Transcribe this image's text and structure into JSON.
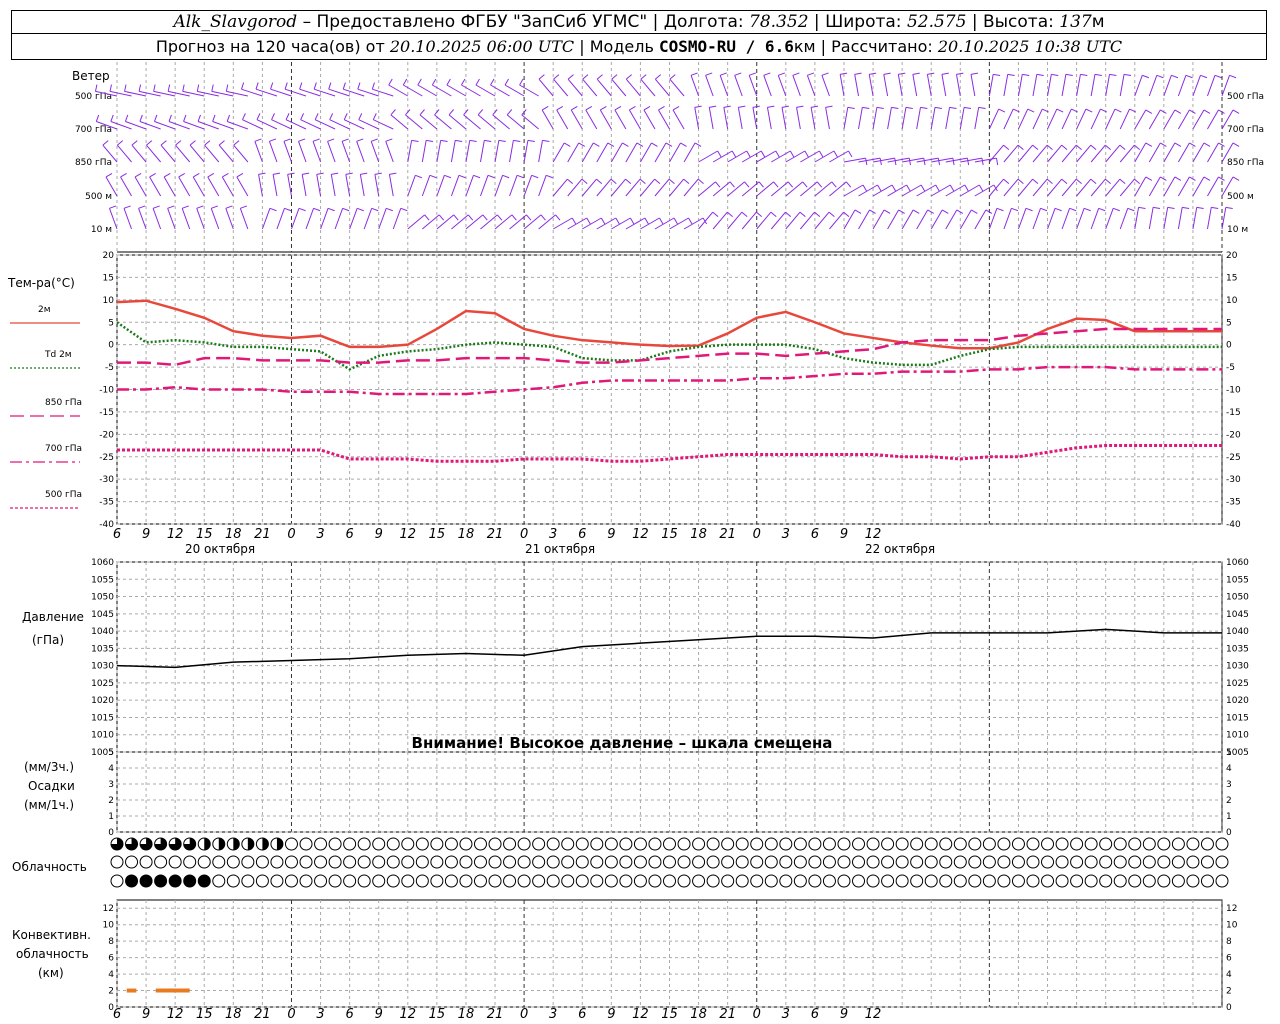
{
  "header": {
    "station": "Alk_Slavgorod",
    "provider": " – Предоставлено ФГБУ \"ЗапСиб УГМС\" | Долгота: ",
    "lon": "78.352",
    "lat_label": " | Широта: ",
    "lat": "52.575",
    "alt_label": " | Высота: ",
    "alt": "137",
    "alt_unit": "м",
    "line2_a": "Прогноз на 120 часа(ов) от ",
    "forecast_start": "20.10.2025 06:00 UTC",
    "line2_b": "  | Модель ",
    "model": "COSMO-RU / 6.6",
    "model_unit": "км",
    "line2_c": " | Рассчитано: ",
    "computed": "20.10.2025 10:38 UTC"
  },
  "wind_panel": {
    "title": "Ветер",
    "levels": [
      "500 гПа",
      "700 гПа",
      "850 гПа",
      "500 м",
      "10 м"
    ]
  },
  "temp_panel": {
    "title": "Тем-ра(°С)",
    "legend": [
      {
        "label": "2м",
        "color": "#e8483c",
        "style": "solid"
      },
      {
        "label": "Td  2м",
        "color": "#1a7a1a",
        "style": "dotted"
      },
      {
        "label": "850 гПа",
        "color": "#e0187a",
        "style": "dash"
      },
      {
        "label": "700 гПа",
        "color": "#e0187a",
        "style": "dashdot"
      },
      {
        "label": "500 гПа",
        "color": "#e0187a",
        "style": "dot"
      }
    ],
    "yticks": [
      "20",
      "15",
      "10",
      "5",
      "0",
      "-5",
      "-10",
      "-15",
      "-20",
      "-25",
      "-30",
      "-35",
      "-40"
    ]
  },
  "x_axis": {
    "hours": [
      "6",
      "9",
      "12",
      "15",
      "18",
      "21",
      "0",
      "3",
      "6",
      "9",
      "12",
      "15",
      "18",
      "21",
      "0",
      "3",
      "6",
      "9",
      "12",
      "15",
      "18",
      "21",
      "0",
      "3",
      "6",
      "9",
      "12"
    ],
    "dates": [
      "20 октября",
      "21 октября",
      "22 октября"
    ]
  },
  "pressure_panel": {
    "title": "Давление",
    "unit": "(гПа)",
    "yticks": [
      "1060",
      "1055",
      "1050",
      "1045",
      "1040",
      "1035",
      "1030",
      "1025",
      "1020",
      "1015",
      "1010",
      "1005"
    ],
    "warning": "Внимание! Высокое давление – шкала смещена"
  },
  "precip_panel": {
    "unit3": "(мм/3ч.)",
    "title": "Осадки",
    "unit1": "(мм/1ч.)",
    "yticks": [
      "5",
      "4",
      "3",
      "2",
      "1",
      "0"
    ]
  },
  "cloud_panel": {
    "title": "Облачность"
  },
  "conv_panel": {
    "title1": "Конвективн.",
    "title2": "облачность",
    "unit": "(км)",
    "yticks": [
      "12",
      "10",
      "8",
      "6",
      "4",
      "2",
      "0"
    ]
  },
  "colors": {
    "wind": "#8a2be2",
    "t2m": "#e8483c",
    "td": "#1a7a1a",
    "upper": "#e0187a",
    "pressure": "#000000",
    "conv": "#e87a20"
  },
  "chart_data": [
    {
      "type": "line",
      "title": "Тем-ра(°С)",
      "x_hours_from_start": [
        0,
        3,
        6,
        9,
        12,
        15,
        18,
        21,
        24,
        27,
        30,
        33,
        36,
        39,
        42,
        45,
        48,
        51,
        54,
        57,
        60,
        63,
        66,
        69,
        72,
        75,
        78,
        81,
        84,
        87,
        90,
        93,
        96,
        99,
        102,
        105,
        108,
        111,
        114
      ],
      "ylim": [
        -40,
        20
      ],
      "series": [
        {
          "name": "2м",
          "values": [
            9.5,
            9.8,
            8,
            6,
            3,
            2,
            1.5,
            2,
            -0.5,
            -0.5,
            0,
            3.5,
            7.5,
            7,
            3.5,
            2,
            1,
            0.5,
            0,
            -0.3,
            -0.2,
            2.5,
            6,
            7.3,
            5,
            2.5,
            1.5,
            0.5,
            -0.2,
            -0.8,
            -0.8,
            0.5,
            3.5,
            5.8,
            5.5,
            3,
            3,
            3,
            3
          ]
        },
        {
          "name": "Td  2м",
          "values": [
            5,
            0.5,
            1,
            0.5,
            -0.5,
            -0.5,
            -1,
            -1.5,
            -5.5,
            -2.5,
            -1.5,
            -1,
            0,
            0.5,
            0,
            -0.5,
            -3,
            -3.5,
            -3.5,
            -1.5,
            -0.5,
            0,
            0,
            0,
            -1,
            -3,
            -4,
            -4.5,
            -4.5,
            -2.5,
            -1,
            -0.5,
            -0.5,
            -0.5,
            -0.5,
            -0.5,
            -0.5,
            -0.5,
            -0.5
          ]
        },
        {
          "name": "850 гПа",
          "values": [
            -4,
            -4,
            -4.5,
            -3,
            -3,
            -3.5,
            -3.5,
            -3.5,
            -4,
            -4,
            -3.5,
            -3.5,
            -3,
            -3,
            -3,
            -3.5,
            -4,
            -4,
            -3.5,
            -3,
            -2.5,
            -2,
            -2,
            -2.5,
            -2,
            -1.5,
            -1,
            0.5,
            1,
            1,
            1,
            2,
            2.5,
            3,
            3.5,
            3.5,
            3.5,
            3.5,
            3.5
          ]
        },
        {
          "name": "700 гПа",
          "values": [
            -10,
            -10,
            -9.5,
            -10,
            -10,
            -10,
            -10.5,
            -10.5,
            -10.5,
            -11,
            -11,
            -11,
            -11,
            -10.5,
            -10,
            -9.5,
            -8.5,
            -8,
            -8,
            -8,
            -8,
            -8,
            -7.5,
            -7.5,
            -7,
            -6.5,
            -6.5,
            -6,
            -6,
            -6,
            -5.5,
            -5.5,
            -5,
            -5,
            -5,
            -5.5,
            -5.5,
            -5.5,
            -5.5
          ]
        },
        {
          "name": "500 гПа",
          "values": [
            -23.5,
            -23.5,
            -23.5,
            -23.5,
            -23.5,
            -23.5,
            -23.5,
            -23.5,
            -25.5,
            -25.5,
            -25.5,
            -26,
            -26,
            -26,
            -25.5,
            -25.5,
            -25.5,
            -26,
            -26,
            -25.5,
            -25,
            -24.5,
            -24.5,
            -24.5,
            -24.5,
            -24.5,
            -24.5,
            -25,
            -25,
            -25.5,
            -25,
            -25,
            -24,
            -23,
            -22.5,
            -22.5,
            -22.5,
            -22.5,
            -22.5
          ]
        }
      ]
    },
    {
      "type": "line",
      "title": "Давление",
      "ylabel": "(гПа)",
      "x_hours_from_start": [
        0,
        6,
        12,
        18,
        24,
        30,
        36,
        42,
        48,
        54,
        60,
        66,
        72,
        78,
        84,
        90,
        96,
        102,
        108,
        114
      ],
      "ylim": [
        1005,
        1060
      ],
      "series": [
        {
          "values": [
            1030,
            1029.5,
            1031,
            1031.5,
            1032,
            1033,
            1033.5,
            1033,
            1035.5,
            1036.5,
            1037.5,
            1038.5,
            1038.5,
            1038,
            1039.5,
            1039.5,
            1039.5,
            1040.5,
            1039.5,
            1039.5
          ]
        }
      ]
    },
    {
      "type": "bar",
      "title": "Конвективн. облачность",
      "ylabel": "(км)",
      "segments_hours": [
        [
          1,
          2
        ],
        [
          4,
          7.5
        ]
      ],
      "value_km": 2
    }
  ]
}
